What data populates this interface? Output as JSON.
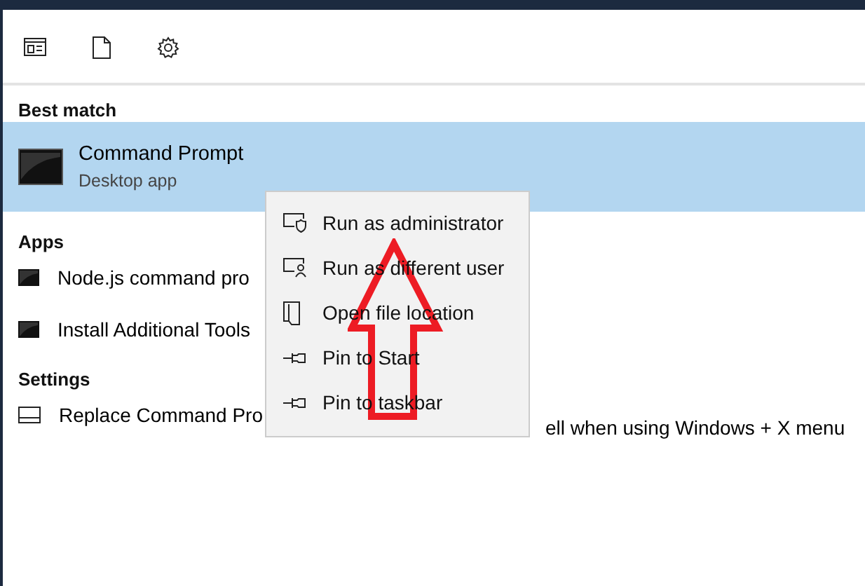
{
  "toolbar": {
    "buttons": [
      {
        "kind": "apps"
      },
      {
        "kind": "documents"
      },
      {
        "kind": "settings"
      }
    ]
  },
  "sections": [
    {
      "heading": "Best match",
      "items": [
        {
          "kind": "large",
          "title": "Command Prompt",
          "subtitle": "Desktop app",
          "selected": true
        }
      ]
    },
    {
      "heading": "Apps",
      "items": [
        {
          "kind": "app",
          "title": "Node.js command pro",
          "selected": false
        },
        {
          "kind": "app",
          "title": "Install Additional Tools",
          "selected": false
        }
      ]
    },
    {
      "heading": "Settings",
      "items": [
        {
          "kind": "setting",
          "title": "Replace Command Pro",
          "title_after": "ell when using Windows + X menu",
          "selected": false
        }
      ]
    }
  ],
  "context_menu": {
    "items": [
      {
        "kind": "admin",
        "label": "Run as administrator"
      },
      {
        "kind": "user",
        "label": "Run as different user"
      },
      {
        "kind": "location",
        "label": "Open file location"
      },
      {
        "kind": "pin",
        "label": "Pin to Start"
      },
      {
        "kind": "pin",
        "label": "Pin to taskbar"
      }
    ]
  }
}
